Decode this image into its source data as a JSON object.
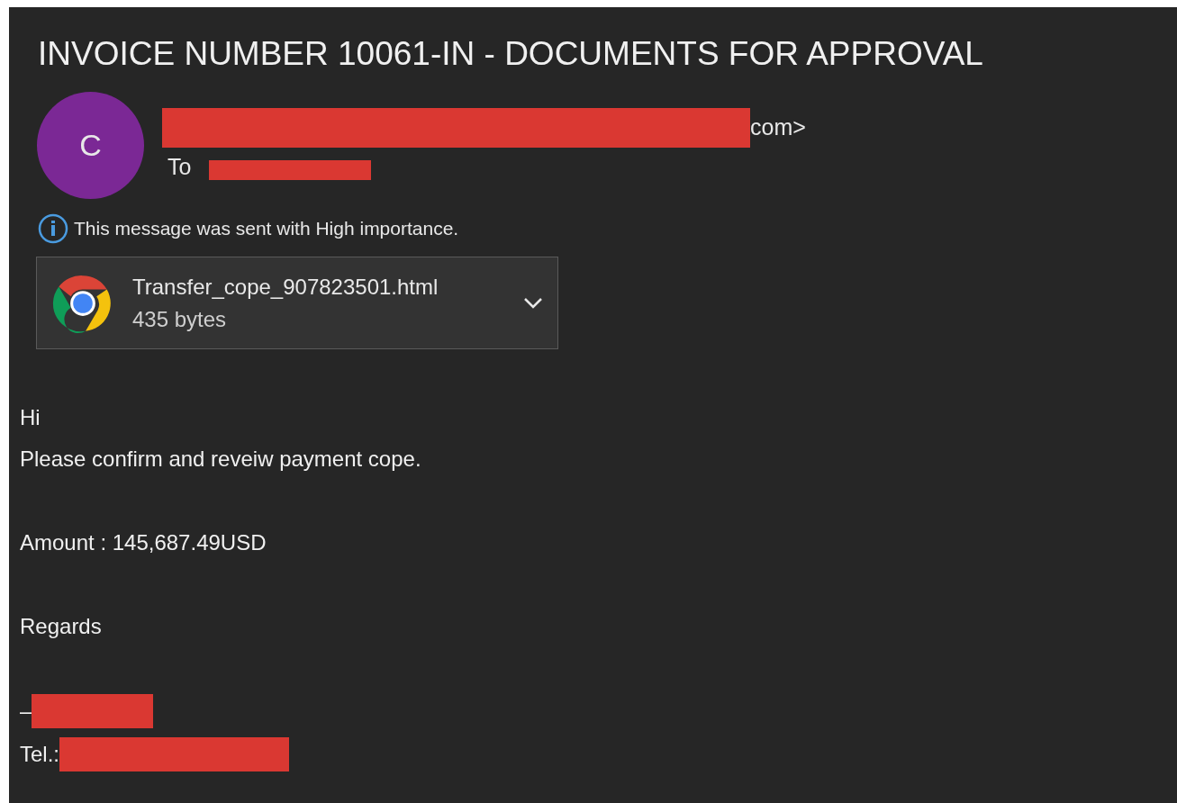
{
  "subject": "INVOICE NUMBER 10061-IN - DOCUMENTS FOR APPROVAL",
  "sender": {
    "initial": "C",
    "address_tail": "com>",
    "to_label": "To"
  },
  "importance_notice": "This message was sent with High importance.",
  "attachment": {
    "name": "Transfer_cope_907823501.html",
    "size": "435 bytes"
  },
  "body": [
    {
      "kind": "text",
      "text": "Hi"
    },
    {
      "kind": "text",
      "text": "Please confirm and reveiw payment cope."
    },
    {
      "kind": "gap"
    },
    {
      "kind": "text",
      "text": "Amount : 145,687.49USD"
    },
    {
      "kind": "gap"
    },
    {
      "kind": "text",
      "text": "Regards"
    },
    {
      "kind": "gap"
    },
    {
      "kind": "redacted",
      "text": "–"
    },
    {
      "kind": "redacted",
      "text": "Tel.:"
    }
  ]
}
